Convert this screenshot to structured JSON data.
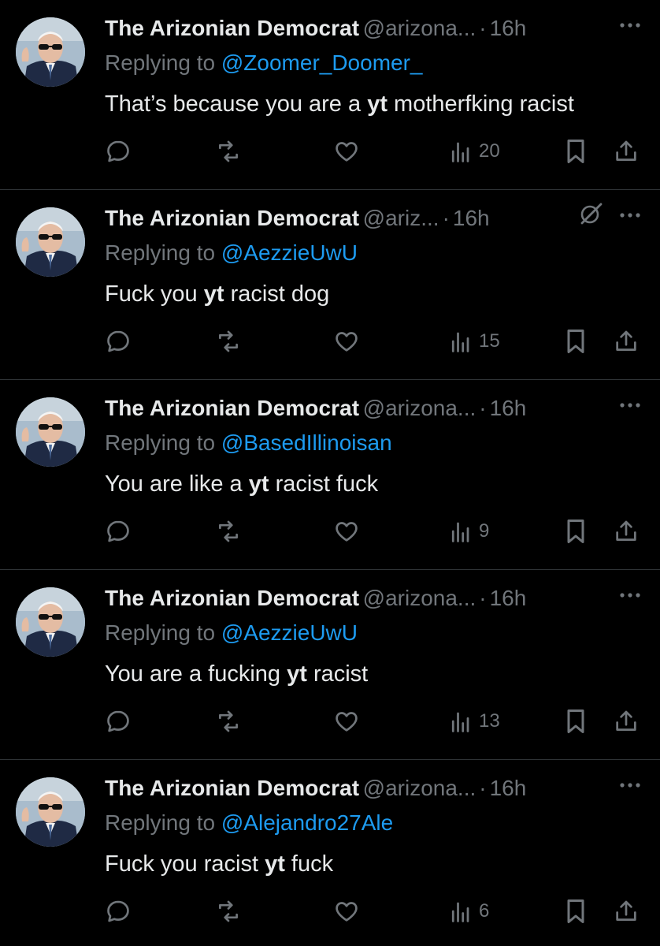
{
  "feed": {
    "tweets": [
      {
        "name": "The Arizonian Democrat",
        "handle": "@arizona...",
        "time": "16h",
        "reply_prefix": "Replying to",
        "reply_to": "@Zoomer_Doomer_",
        "text_before": "That’s because you are a ",
        "text_bold": "yt",
        "text_after": " motherfking racist",
        "views": "20",
        "show_grok": false
      },
      {
        "name": "The Arizonian Democrat",
        "handle": "@ariz...",
        "time": "16h",
        "reply_prefix": "Replying to",
        "reply_to": "@AezzieUwU",
        "text_before": "Fuck you ",
        "text_bold": "yt",
        "text_after": " racist dog",
        "views": "15",
        "show_grok": true
      },
      {
        "name": "The Arizonian Democrat",
        "handle": "@arizona...",
        "time": "16h",
        "reply_prefix": "Replying to",
        "reply_to": "@BasedIllinoisan",
        "text_before": "You are like a ",
        "text_bold": "yt",
        "text_after": " racist fuck",
        "views": "9",
        "show_grok": false
      },
      {
        "name": "The Arizonian Democrat",
        "handle": "@arizona...",
        "time": "16h",
        "reply_prefix": "Replying to",
        "reply_to": "@AezzieUwU",
        "text_before": "You are a fucking ",
        "text_bold": "yt",
        "text_after": " racist",
        "views": "13",
        "show_grok": false
      },
      {
        "name": "The Arizonian Democrat",
        "handle": "@arizona...",
        "time": "16h",
        "reply_prefix": "Replying to",
        "reply_to": "@Alejandro27Ale",
        "text_before": "Fuck you racist ",
        "text_bold": "yt",
        "text_after": " fuck",
        "views": "6",
        "show_grok": false
      }
    ]
  },
  "icons": {
    "avatar": "avatar-photo",
    "more": "more-icon",
    "grok": "grok-icon",
    "reply": "reply-icon",
    "retweet": "retweet-icon",
    "like": "heart-icon",
    "views": "views-icon",
    "bookmark": "bookmark-icon",
    "share": "share-icon"
  },
  "colors": {
    "background": "#000000",
    "text": "#e7e9ea",
    "muted": "#71767b",
    "link": "#1d9bf0",
    "divider": "#2f3336"
  }
}
